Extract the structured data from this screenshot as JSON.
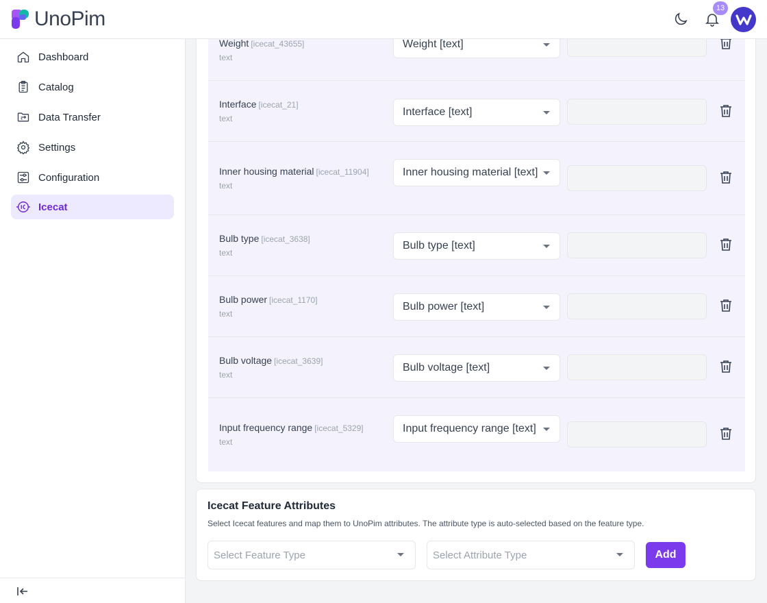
{
  "app": {
    "name": "UnoPim",
    "notification_count": "13",
    "avatar_letter": "W"
  },
  "sidebar": {
    "items": [
      {
        "label": "Dashboard",
        "icon": "home-icon"
      },
      {
        "label": "Catalog",
        "icon": "clipboard-list-icon"
      },
      {
        "label": "Data Transfer",
        "icon": "folder-transfer-icon"
      },
      {
        "label": "Settings",
        "icon": "gear-icon"
      },
      {
        "label": "Configuration",
        "icon": "sliders-icon"
      },
      {
        "label": "Icecat",
        "icon": "icecat-icon",
        "active": true
      }
    ]
  },
  "mapping_rows": [
    {
      "name": "Weight",
      "code": "[icecat_43655]",
      "type": "text",
      "selected": "Weight [text]",
      "value": ""
    },
    {
      "name": "Interface",
      "code": "[icecat_21]",
      "type": "text",
      "selected": "Interface [text]",
      "value": ""
    },
    {
      "name": "Inner housing material",
      "code": "[icecat_11904]",
      "type": "text",
      "selected": "Inner housing material [text]",
      "value": ""
    },
    {
      "name": "Bulb type",
      "code": "[icecat_3638]",
      "type": "text",
      "selected": "Bulb type [text]",
      "value": ""
    },
    {
      "name": "Bulb power",
      "code": "[icecat_1170]",
      "type": "text",
      "selected": "Bulb power [text]",
      "value": ""
    },
    {
      "name": "Bulb voltage",
      "code": "[icecat_3639]",
      "type": "text",
      "selected": "Bulb voltage [text]",
      "value": ""
    },
    {
      "name": "Input frequency range",
      "code": "[icecat_5329]",
      "type": "text",
      "selected": "Input frequency range [text]",
      "value": ""
    }
  ],
  "feature_attributes": {
    "title": "Icecat Feature Attributes",
    "description": "Select Icecat features and map them to UnoPim attributes. The attribute type is auto-selected based on the feature type.",
    "feature_placeholder": "Select Feature Type",
    "attribute_placeholder": "Select Attribute Type",
    "add_label": "Add"
  },
  "colors": {
    "accent": "#7c3aed",
    "active_bg": "#ede9fe",
    "row_bg": "#f4f3fd"
  }
}
